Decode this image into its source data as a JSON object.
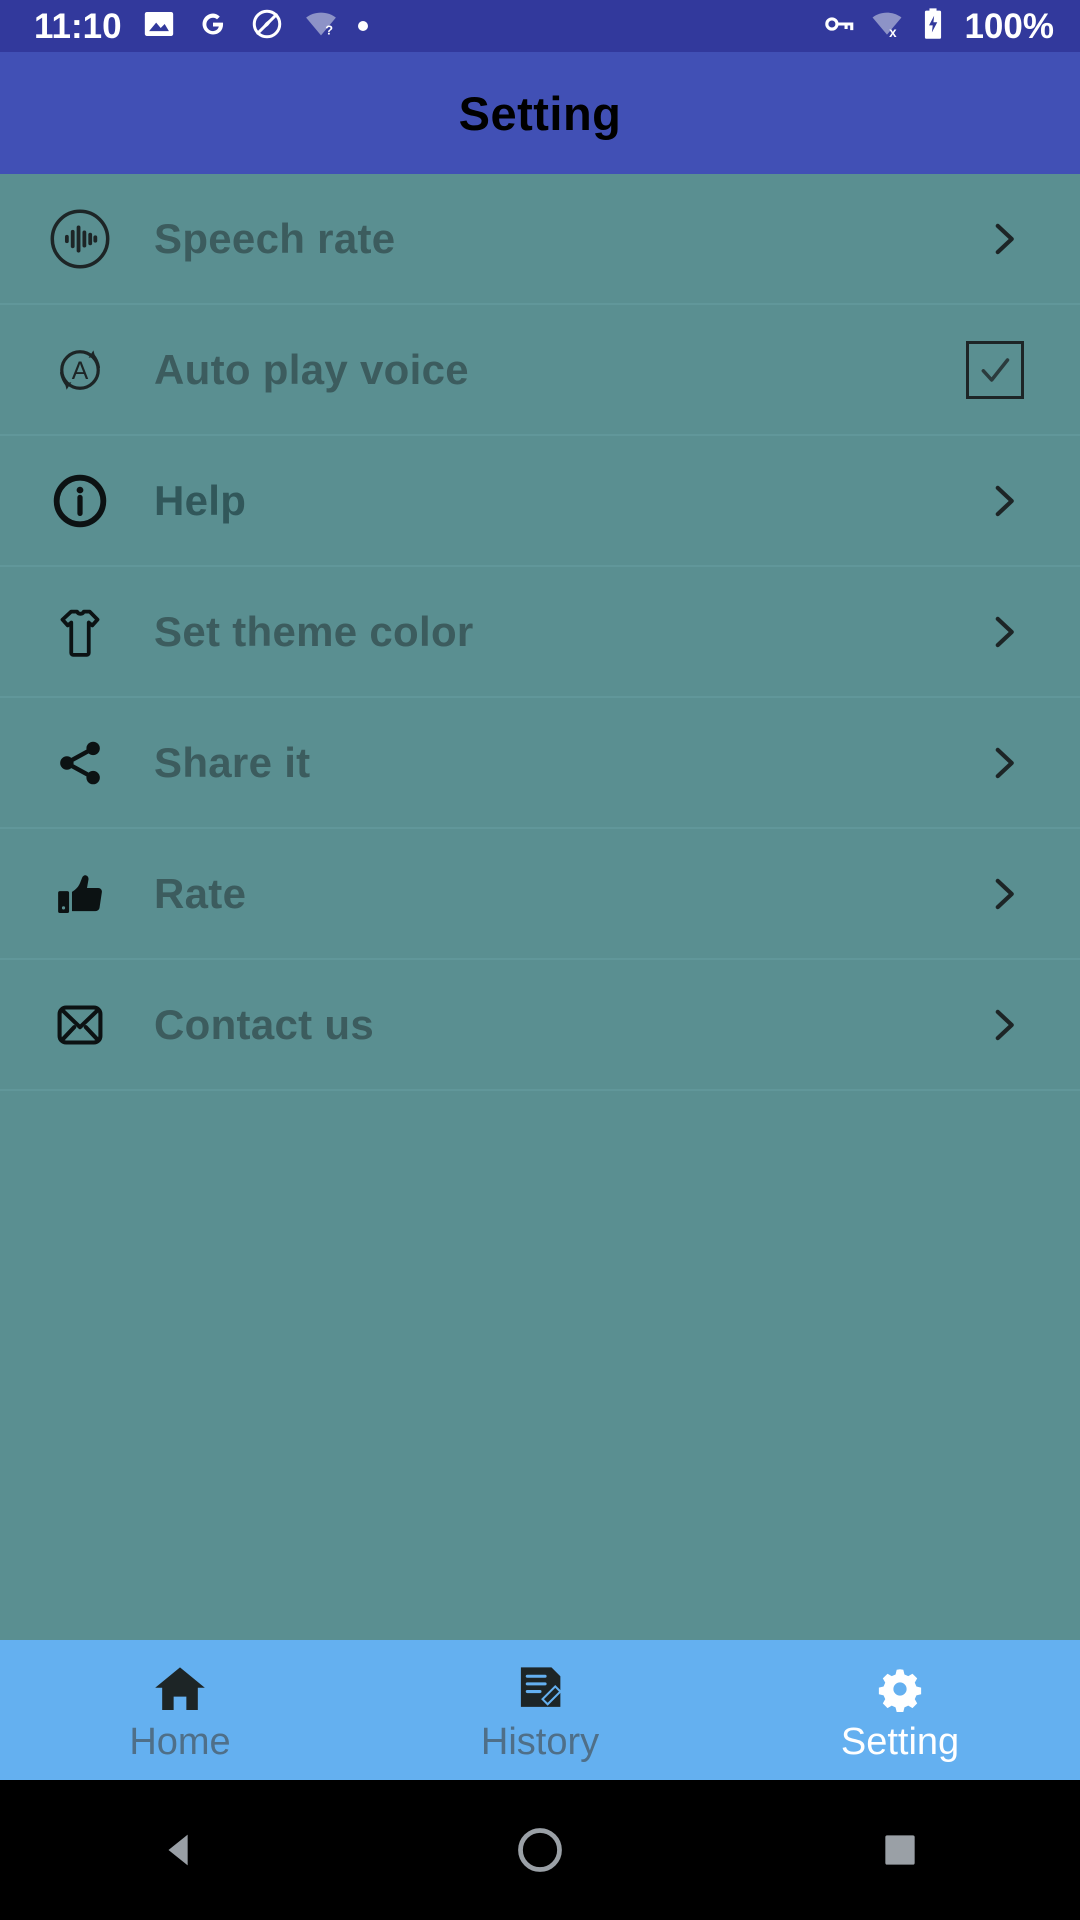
{
  "status_bar": {
    "time": "11:10",
    "battery_percent": "100%",
    "left_icons": [
      "image-icon",
      "google-g-icon",
      "circle-slash-icon",
      "wifi-question-icon",
      "dot-icon"
    ],
    "right_icons": [
      "vpn-key-icon",
      "wifi-off-icon",
      "battery-charging-icon"
    ],
    "background_color": "#32399c"
  },
  "app_bar": {
    "title": "Setting",
    "background_color": "#4150b5",
    "title_color": "#000000"
  },
  "content": {
    "background_color": "#5a8f91",
    "divider_color": "#61979a"
  },
  "settings": {
    "items": [
      {
        "label": "Speech rate",
        "icon": "speech-waveform-icon",
        "control": "chevron"
      },
      {
        "label": "Auto play voice",
        "icon": "auto-repeat-a-icon",
        "control": "checkbox",
        "checked": true
      },
      {
        "label": "Help",
        "icon": "info-circle-icon",
        "control": "chevron"
      },
      {
        "label": "Set theme color",
        "icon": "tshirt-icon",
        "control": "chevron"
      },
      {
        "label": "Share it",
        "icon": "share-icon",
        "control": "chevron"
      },
      {
        "label": "Rate",
        "icon": "thumbs-up-icon",
        "control": "chevron"
      },
      {
        "label": "Contact us",
        "icon": "envelope-icon",
        "control": "chevron"
      }
    ]
  },
  "bottom_nav": {
    "background_color": "#64b0f0",
    "active_color": "#ffffff",
    "inactive_color": "#4f6f88",
    "items": [
      {
        "label": "Home",
        "icon": "home-icon",
        "active": false
      },
      {
        "label": "History",
        "icon": "history-note-icon",
        "active": false
      },
      {
        "label": "Setting",
        "icon": "gear-icon",
        "active": true
      }
    ]
  },
  "system_nav": {
    "background_color": "#000000",
    "buttons": [
      "back-triangle-icon",
      "home-circle-icon",
      "recents-square-icon"
    ]
  }
}
